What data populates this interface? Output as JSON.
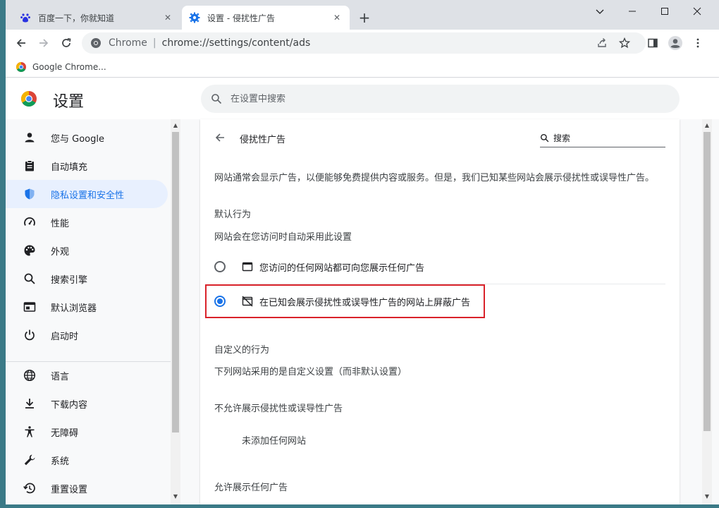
{
  "tabs": [
    {
      "title": "百度一下，你就知道",
      "icon": "baidu-icon"
    },
    {
      "title": "设置 - 侵扰性广告",
      "icon": "settings-gear-icon"
    }
  ],
  "address": {
    "scheme_label": "Chrome",
    "url": "chrome://settings/content/ads"
  },
  "bookmarks": [
    {
      "label": "Google Chrome..."
    }
  ],
  "settings": {
    "title": "设置",
    "search_placeholder": "在设置中搜索"
  },
  "sidebar": {
    "items": [
      {
        "label": "您与 Google",
        "icon": "person-icon"
      },
      {
        "label": "自动填充",
        "icon": "clipboard-icon"
      },
      {
        "label": "隐私设置和安全性",
        "icon": "shield-icon"
      },
      {
        "label": "性能",
        "icon": "speedometer-icon"
      },
      {
        "label": "外观",
        "icon": "palette-icon"
      },
      {
        "label": "搜索引擎",
        "icon": "search-icon"
      },
      {
        "label": "默认浏览器",
        "icon": "browser-icon"
      },
      {
        "label": "启动时",
        "icon": "power-icon"
      },
      {
        "label": "语言",
        "icon": "globe-icon"
      },
      {
        "label": "下载内容",
        "icon": "download-icon"
      },
      {
        "label": "无障碍",
        "icon": "accessibility-icon"
      },
      {
        "label": "系统",
        "icon": "wrench-icon"
      },
      {
        "label": "重置设置",
        "icon": "restore-icon"
      }
    ],
    "selected_index": 2
  },
  "content": {
    "title": "侵扰性广告",
    "search_placeholder": "搜索",
    "description": "网站通常会显示广告，以便能够免费提供内容或服务。但是，我们已知某些网站会展示侵扰性或误导性广告。",
    "default_heading": "默认行为",
    "default_sub": "网站会在您访问时自动采用此设置",
    "options": [
      {
        "label": "您访问的任何网站都可向您展示任何广告",
        "icon": "window-icon",
        "checked": false
      },
      {
        "label": "在已知会展示侵扰性或误导性广告的网站上屏蔽广告",
        "icon": "ads-blocked-icon",
        "checked": true
      }
    ],
    "custom_heading": "自定义的行为",
    "custom_sub": "下列网站采用的是自定义设置（而非默认设置）",
    "disallow_heading": "不允许展示侵扰性或误导性广告",
    "disallow_empty": "未添加任何网站",
    "allow_heading": "允许展示任何广告"
  },
  "colors": {
    "accent": "#1a73e8",
    "highlight": "#d9222a",
    "selected_bg": "#e8f0fe"
  }
}
